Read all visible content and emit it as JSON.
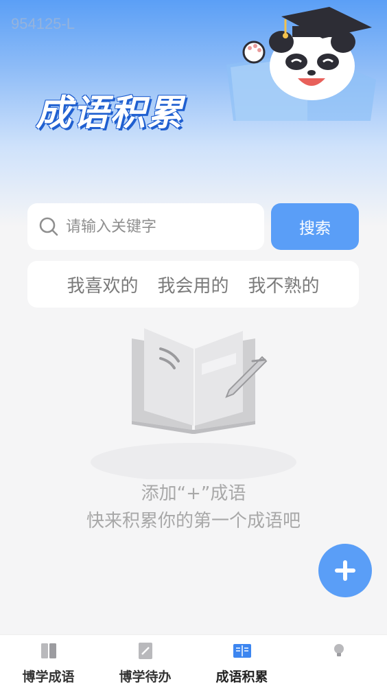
{
  "watermark": "954125-L",
  "header": {
    "title": "成语积累"
  },
  "search": {
    "placeholder": "请输入关键字",
    "value": "",
    "button_label": "搜索"
  },
  "filters": [
    {
      "label": "我喜欢的"
    },
    {
      "label": "我会用的"
    },
    {
      "label": "我不熟的"
    }
  ],
  "empty_state": {
    "line1": "添加“+”成语",
    "line2": "快来积累你的第一个成语吧"
  },
  "tabs": [
    {
      "label": "博学成语",
      "icon": "book-icon",
      "active": false
    },
    {
      "label": "博学待办",
      "icon": "notepad-icon",
      "active": false
    },
    {
      "label": "成语积累",
      "icon": "open-book-icon",
      "active": true
    },
    {
      "label": "",
      "icon": "lightbulb-icon",
      "active": false
    }
  ],
  "colors": {
    "accent": "#5a9ef7",
    "title_outline": "#1f5fd0"
  }
}
